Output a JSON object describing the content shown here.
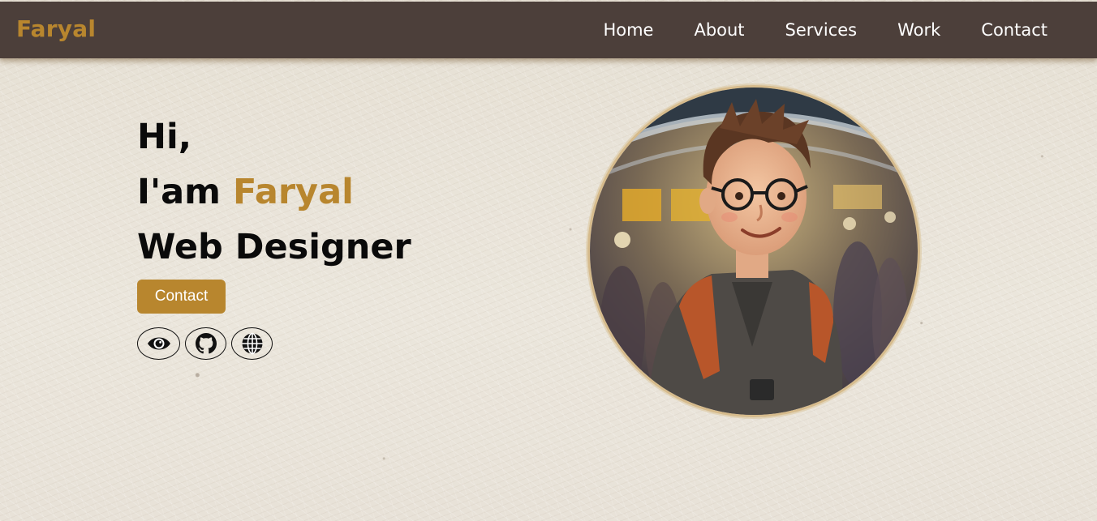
{
  "navbar": {
    "logo": "Faryal",
    "links": [
      {
        "label": "Home"
      },
      {
        "label": "About"
      },
      {
        "label": "Services"
      },
      {
        "label": "Work"
      },
      {
        "label": "Contact"
      }
    ]
  },
  "hero": {
    "greeting": "Hi,",
    "intro_prefix": "I'am",
    "name": "Faryal",
    "role": "Web Designer",
    "contact_button": "Contact",
    "social_icons": [
      {
        "name": "eye-icon"
      },
      {
        "name": "github-icon"
      },
      {
        "name": "globe-icon"
      }
    ]
  },
  "colors": {
    "navbar_bg": "#4c3f3a",
    "accent": "#b8862e",
    "text": "#0a0a0a",
    "background": "#e9e4da"
  }
}
